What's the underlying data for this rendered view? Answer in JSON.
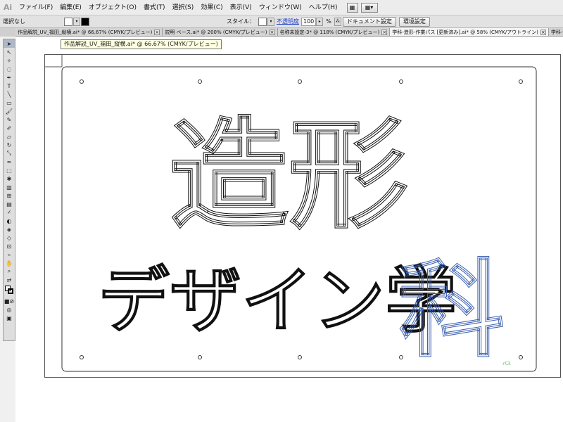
{
  "app": {
    "logo": "Ai"
  },
  "menu": [
    "ファイル(F)",
    "編集(E)",
    "オブジェクト(O)",
    "書式(T)",
    "選択(S)",
    "効果(C)",
    "表示(V)",
    "ウィンドウ(W)",
    "ヘルプ(H)"
  ],
  "control": {
    "selection_label": "選択なし",
    "style_label": "スタイル：",
    "opacity_link": "不透明度",
    "opacity_value": "100",
    "opacity_unit": "%",
    "doc_settings": "ドキュメント設定",
    "prefs": "環境設定"
  },
  "tabs": [
    {
      "label": "作品解説_UV_福田_縦横.ai* @ 66.67% (CMYK/プレビュー)",
      "active": false
    },
    {
      "label": "説明 ベース.ai* @ 200% (CMYK/プレビュー)",
      "active": false
    },
    {
      "label": "名称未設定-3* @ 118% (CMYK/プレビュー)",
      "active": false
    },
    {
      "label": "学科-造形-作業パス [更新済み].ai* @ 58% (CMYK/アウトライン)",
      "active": true
    },
    {
      "label": "学科-造形-補整アクリル・カット用.ai",
      "active": false
    }
  ],
  "tooltip": "作品解説_UV_福田_縦横.ai* @ 66.67% (CMYK/プレビュー)",
  "tools": [
    "selection-tool",
    "direct-selection-tool",
    "magic-wand-tool",
    "lasso-tool",
    "pen-tool",
    "type-tool",
    "line-tool",
    "rectangle-tool",
    "paintbrush-tool",
    "pencil-tool",
    "blob-brush-tool",
    "eraser-tool",
    "rotate-tool",
    "scale-tool",
    "warp-tool",
    "free-transform-tool",
    "symbol-sprayer-tool",
    "graph-tool",
    "mesh-tool",
    "gradient-tool",
    "eyedropper-tool",
    "blend-tool",
    "live-paint-tool",
    "live-paint-selection-tool",
    "artboard-tool",
    "slice-tool",
    "hand-tool",
    "zoom-tool"
  ],
  "artwork": {
    "line1": "造形",
    "line2": "デザイン学",
    "line2_selected": "科",
    "path_label": "パス",
    "outline_color": "#111111",
    "selected_color": "#3a5fb0"
  },
  "colors": {
    "menubar": "#ececec",
    "canvas": "#ffffff",
    "accent": "#1a3fc8"
  }
}
